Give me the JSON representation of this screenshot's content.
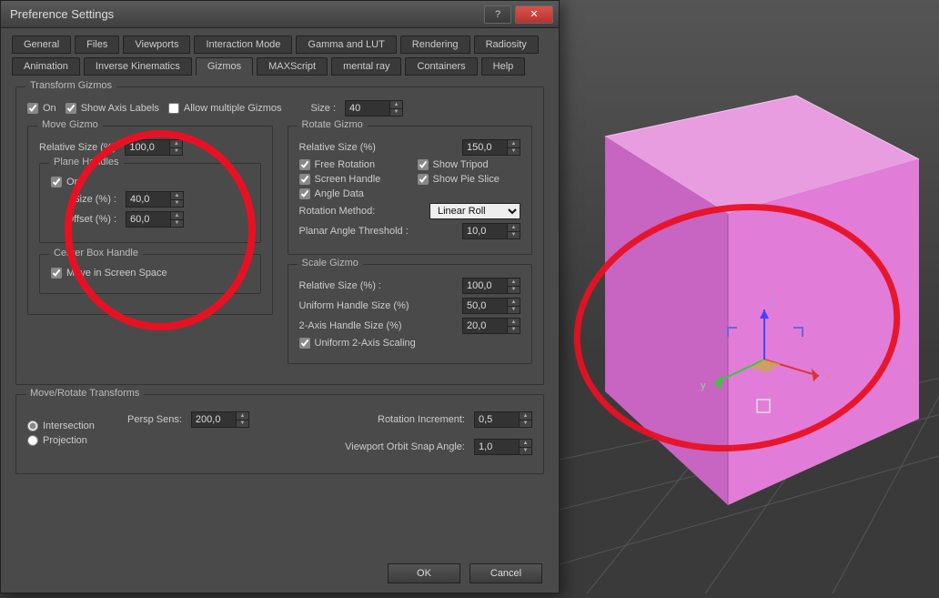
{
  "window": {
    "title": "Preference Settings"
  },
  "tabs_row1": [
    "General",
    "Files",
    "Viewports",
    "Interaction Mode",
    "Gamma and LUT",
    "Rendering",
    "Radiosity"
  ],
  "tabs_row2": [
    "Animation",
    "Inverse Kinematics",
    "Gizmos",
    "MAXScript",
    "mental ray",
    "Containers",
    "Help"
  ],
  "active_tab": "Gizmos",
  "transform": {
    "legend": "Transform Gizmos",
    "on": "On",
    "show_axis": "Show Axis Labels",
    "allow_multi": "Allow multiple Gizmos",
    "size_label": "Size :",
    "size": "40"
  },
  "move": {
    "legend": "Move Gizmo",
    "rel_label": "Relative Size (%)",
    "rel": "100,0",
    "plane_legend": "Plane Handles",
    "plane_on": "On",
    "size_label": "Size (%) :",
    "size": "40,0",
    "offset_label": "Offset (%) :",
    "offset": "60,0",
    "center_legend": "Center Box Handle",
    "move_screen": "Move in Screen Space"
  },
  "rotate": {
    "legend": "Rotate Gizmo",
    "rel_label": "Relative Size (%)",
    "rel": "150,0",
    "free": "Free Rotation",
    "tripod": "Show Tripod",
    "screen": "Screen Handle",
    "pie": "Show Pie Slice",
    "angle": "Angle Data",
    "method_label": "Rotation Method:",
    "method": "Linear Roll",
    "planar_label": "Planar Angle Threshold :",
    "planar": "10,0"
  },
  "scale": {
    "legend": "Scale Gizmo",
    "rel_label": "Relative Size (%) :",
    "rel": "100,0",
    "uh_label": "Uniform Handle Size (%)",
    "uh": "50,0",
    "ax2_label": "2-Axis Handle Size (%)",
    "ax2": "20,0",
    "uniform": "Uniform 2-Axis Scaling"
  },
  "mrt": {
    "legend": "Move/Rotate Transforms",
    "intersection": "Intersection",
    "projection": "Projection",
    "persp_label": "Persp Sens:",
    "persp": "200,0",
    "rotinc_label": "Rotation Increment:",
    "rotinc": "0,5",
    "orbit_label": "Viewport Orbit Snap Angle:",
    "orbit": "1,0"
  },
  "buttons": {
    "ok": "OK",
    "cancel": "Cancel"
  },
  "viewport": {
    "axes": {
      "x": "x",
      "y": "y",
      "z": "z"
    }
  }
}
